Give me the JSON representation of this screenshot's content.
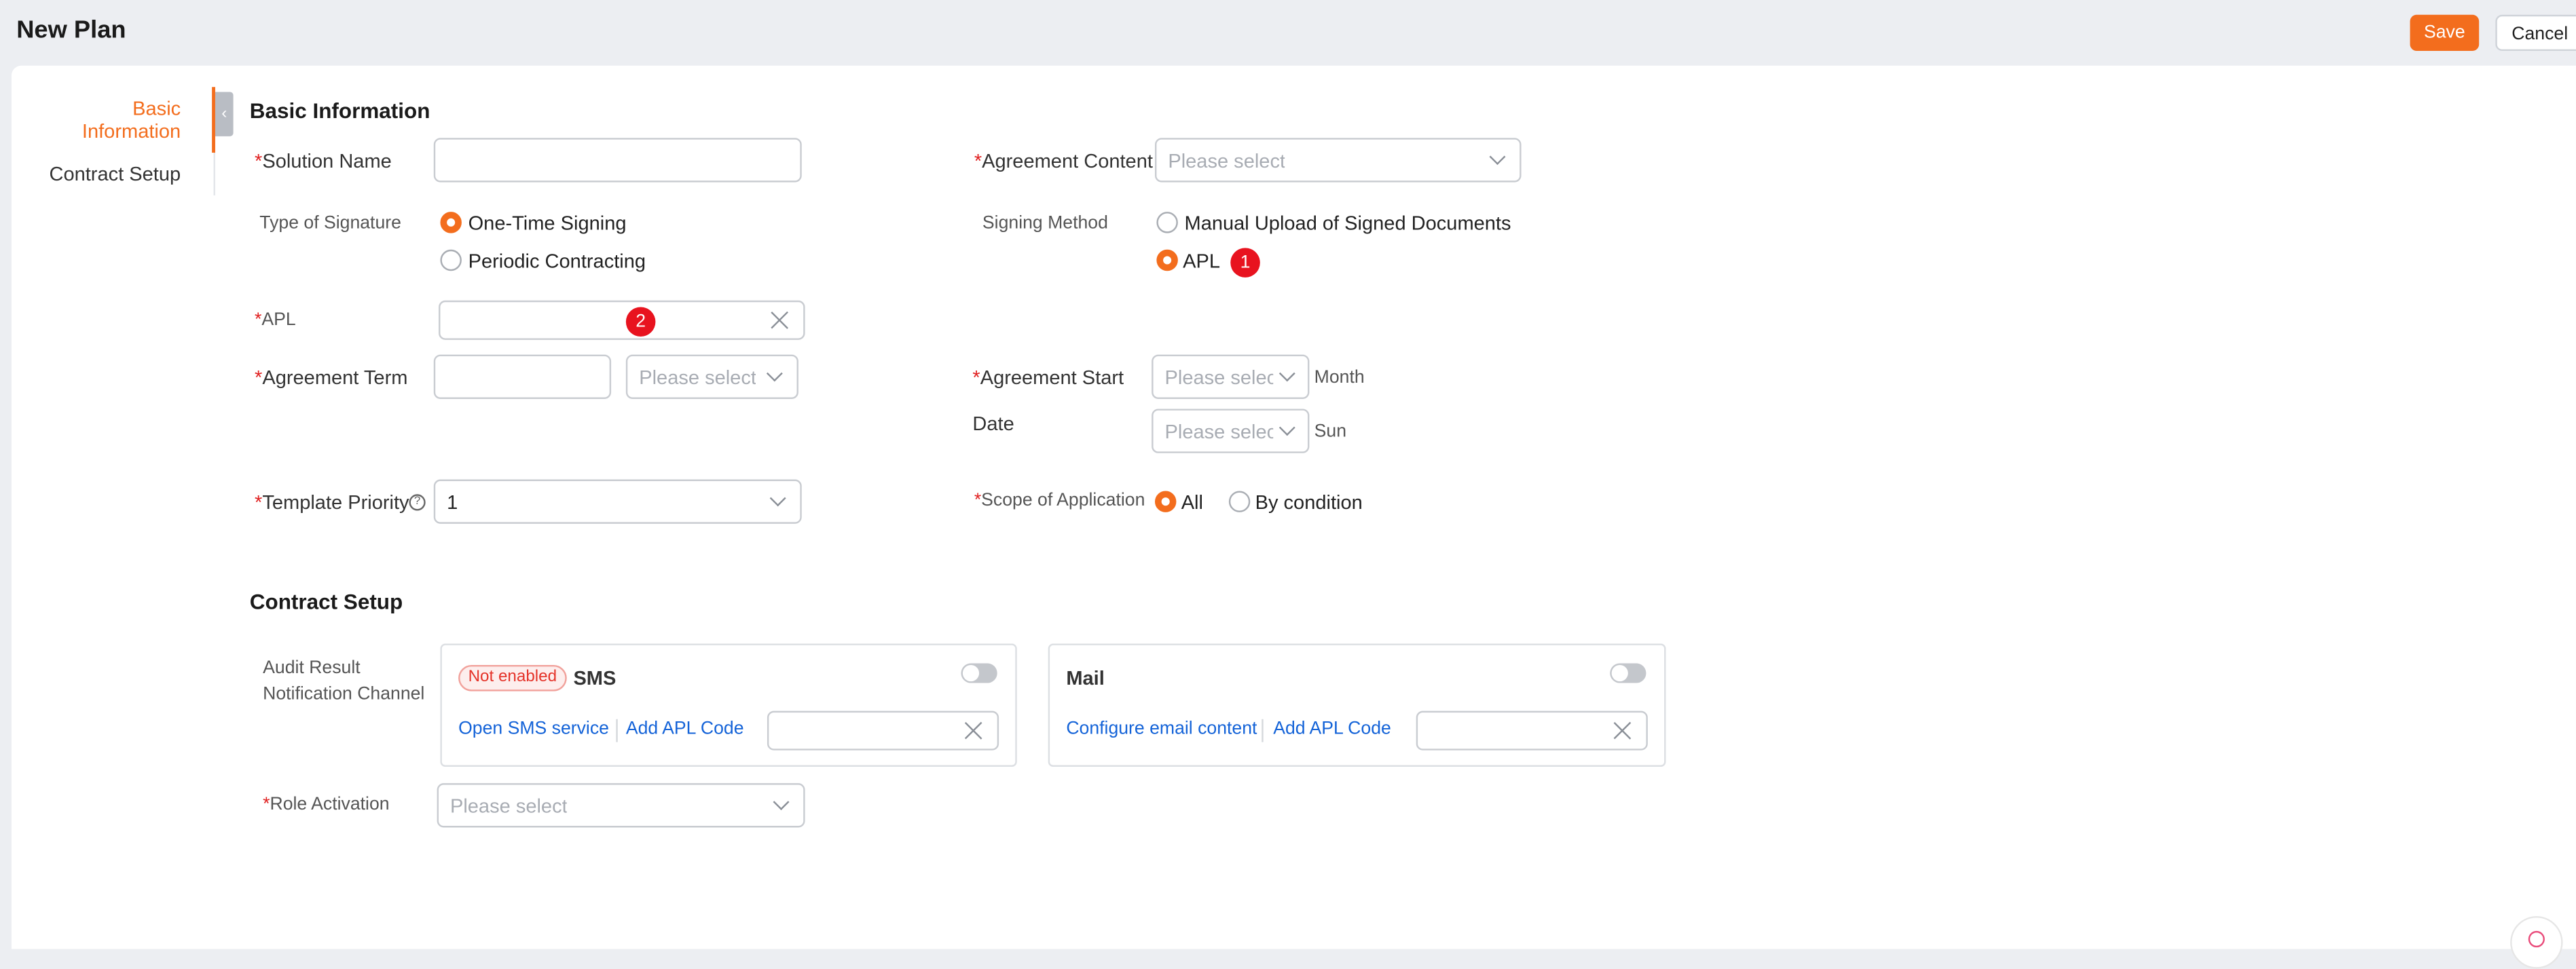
{
  "header": {
    "title": "New Plan",
    "save_label": "Save",
    "cancel_label": "Cancel"
  },
  "nav": {
    "basic_information": "Basic Information",
    "contract_setup": "Contract Setup"
  },
  "collapse_glyph": "‹",
  "basic": {
    "title": "Basic Information",
    "solution_name": {
      "label": "Solution Name",
      "value": ""
    },
    "agreement_content": {
      "label": "Agreement Content",
      "placeholder": "Please select"
    },
    "type_of_signature": {
      "label": "Type of Signature",
      "options": [
        "One-Time Signing",
        "Periodic Contracting"
      ],
      "selected": "One-Time Signing"
    },
    "signing_method": {
      "label": "Signing Method",
      "options": [
        "Manual Upload of Signed Documents",
        "APL"
      ],
      "selected": "APL"
    },
    "apl": {
      "label": "APL",
      "value": ""
    },
    "agreement_term": {
      "label": "Agreement Term",
      "value": "",
      "unit_placeholder": "Please select"
    },
    "agreement_start": {
      "label_line1": "Agreement Start",
      "label_line2": "Date",
      "month_placeholder": "Please selec",
      "month_unit": "Month",
      "day_placeholder": "Please selec",
      "day_unit": "Sun"
    },
    "template_priority": {
      "label": "Template Priority",
      "help_glyph": "?",
      "value": "1"
    },
    "scope_of_application": {
      "label": "Scope of Application",
      "options": [
        "All",
        "By condition"
      ],
      "selected": "All"
    }
  },
  "contract": {
    "title": "Contract Setup",
    "audit_label_line1": "Audit Result",
    "audit_label_line2": "Notification Channel",
    "sms": {
      "tag": "Not enabled",
      "title": "SMS",
      "enabled": false,
      "link1": "Open SMS service",
      "link2": "Add APL Code",
      "value": ""
    },
    "mail": {
      "title": "Mail",
      "enabled": false,
      "link1": "Configure email content",
      "link2": "Add APL Code",
      "value": ""
    },
    "role_activation": {
      "label": "Role Activation",
      "placeholder": "Please select"
    }
  },
  "required_mark": "*",
  "annotations": {
    "badge1": "1",
    "badge2": "2"
  },
  "colors": {
    "accent": "#f36d1d",
    "link": "#1463d8",
    "required": "#e02020",
    "badge": "#e8131f"
  }
}
